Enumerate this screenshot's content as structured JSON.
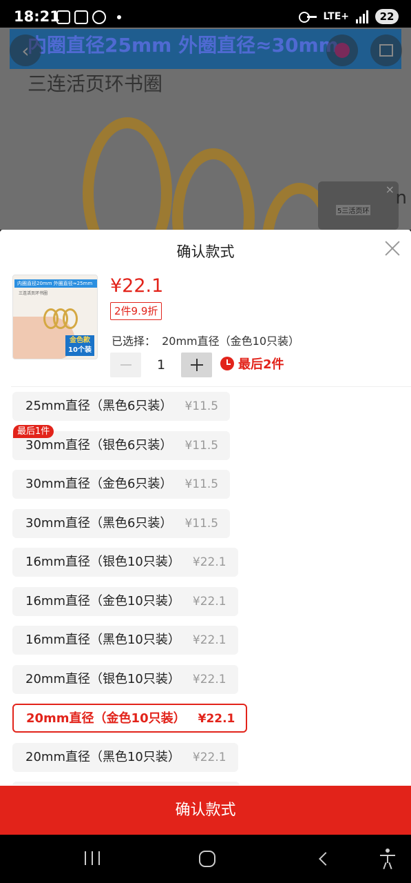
{
  "status_bar": {
    "time": "18:21",
    "network": "LTE+",
    "battery": "22"
  },
  "background_page": {
    "banner_text": "内圈直径25mm    外圈直径≈30mm",
    "product_title": "三连活页环书圈",
    "side_text": "n",
    "video_label": "5三活页环"
  },
  "sheet": {
    "title": "确认款式",
    "thumbnail": {
      "header": "内圈直径20mm   外圈直径≈25mm",
      "subtitle": "三连活页环书圈",
      "badge_line1": "金色款",
      "badge_line2": "10个装"
    },
    "price": "¥22.1",
    "promo": "2件9.9折",
    "selected_label": "已选择：",
    "selected_value": "20mm直径（金色10只装）",
    "quantity": "1",
    "stock_warning": "最后2件",
    "options": [
      {
        "label": "25mm直径（黑色6只装）",
        "price": "¥11.5",
        "badge": "",
        "selected": false
      },
      {
        "label": "30mm直径（银色6只装）",
        "price": "¥11.5",
        "badge": "最后1件",
        "selected": false
      },
      {
        "label": "30mm直径（金色6只装）",
        "price": "¥11.5",
        "badge": "",
        "selected": false
      },
      {
        "label": "30mm直径（黑色6只装）",
        "price": "¥11.5",
        "badge": "",
        "selected": false
      },
      {
        "label": "16mm直径（银色10只装）",
        "price": "¥22.1",
        "badge": "",
        "selected": false
      },
      {
        "label": "16mm直径（金色10只装）",
        "price": "¥22.1",
        "badge": "",
        "selected": false
      },
      {
        "label": "16mm直径（黑色10只装）",
        "price": "¥22.1",
        "badge": "",
        "selected": false
      },
      {
        "label": "20mm直径（银色10只装）",
        "price": "¥22.1",
        "badge": "",
        "selected": false
      },
      {
        "label": "20mm直径（金色10只装）",
        "price": "¥22.1",
        "badge": "",
        "selected": true
      },
      {
        "label": "20mm直径（黑色10只装）",
        "price": "¥22.1",
        "badge": "",
        "selected": false
      }
    ],
    "confirm_button": "确认款式"
  },
  "colors": {
    "accent": "#e2231a",
    "option_bg": "#f4f4f4",
    "muted_price": "#999999"
  }
}
